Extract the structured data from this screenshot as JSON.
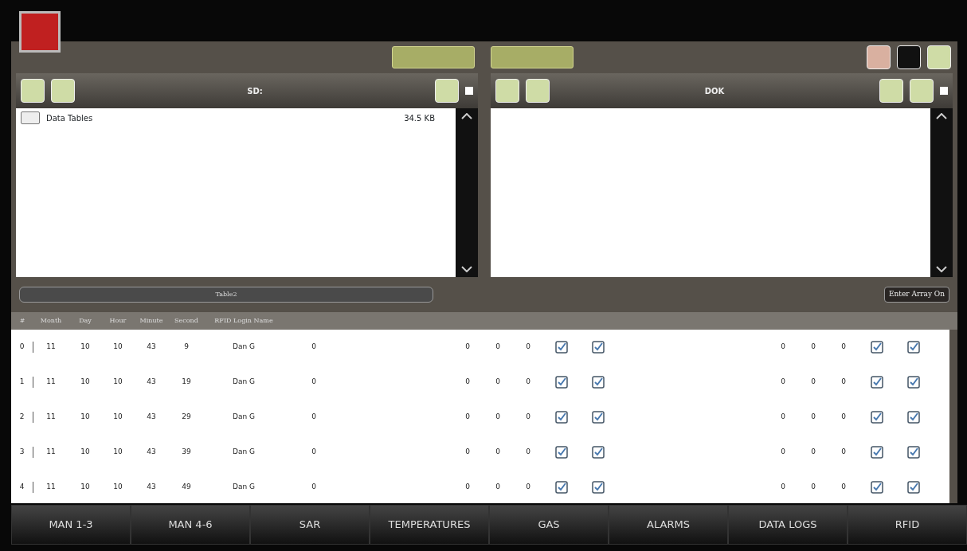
{
  "left_pane": {
    "title": "SD:",
    "select_all": false,
    "files": [
      {
        "name": "Data Tables",
        "size": "34.5 KB"
      }
    ]
  },
  "right_pane": {
    "title": "DOK",
    "select_all": false
  },
  "table": {
    "title": "Table2",
    "action": "Enter Array On",
    "columns": [
      "#",
      "Month",
      "Day",
      "Hour",
      "Minute",
      "Second",
      "RFID Login Name"
    ],
    "rows": [
      {
        "cells": [
          "0",
          "11",
          "10",
          "10",
          "43",
          "9",
          "Dan G",
          "0",
          "",
          "0",
          "0",
          "0"
        ],
        "checks": [
          true,
          true
        ],
        "tail": [
          "0",
          "0",
          "0"
        ],
        "tail_checks": [
          true,
          true
        ]
      },
      {
        "cells": [
          "1",
          "11",
          "10",
          "10",
          "43",
          "19",
          "Dan G",
          "0",
          "",
          "0",
          "0",
          "0"
        ],
        "checks": [
          true,
          true
        ],
        "tail": [
          "0",
          "0",
          "0"
        ],
        "tail_checks": [
          true,
          true
        ]
      },
      {
        "cells": [
          "2",
          "11",
          "10",
          "10",
          "43",
          "29",
          "Dan G",
          "0",
          "",
          "0",
          "0",
          "0"
        ],
        "checks": [
          true,
          true
        ],
        "tail": [
          "0",
          "0",
          "0"
        ],
        "tail_checks": [
          true,
          true
        ]
      },
      {
        "cells": [
          "3",
          "11",
          "10",
          "10",
          "43",
          "39",
          "Dan G",
          "0",
          "",
          "0",
          "0",
          "0"
        ],
        "checks": [
          true,
          true
        ],
        "tail": [
          "0",
          "0",
          "0"
        ],
        "tail_checks": [
          true,
          true
        ]
      },
      {
        "cells": [
          "4",
          "11",
          "10",
          "10",
          "43",
          "49",
          "Dan G",
          "0",
          "",
          "0",
          "0",
          "0"
        ],
        "checks": [
          true,
          true
        ],
        "tail": [
          "0",
          "0",
          "0"
        ],
        "tail_checks": [
          true,
          true
        ]
      }
    ]
  },
  "tabs": [
    {
      "label": "MAN 1-3",
      "selected": false
    },
    {
      "label": "MAN 4-6",
      "selected": false
    },
    {
      "label": "SAR",
      "selected": false
    },
    {
      "label": "TEMPERATURES",
      "selected": false
    },
    {
      "label": "GAS",
      "selected": false
    },
    {
      "label": "ALARMS",
      "selected": false
    },
    {
      "label": "DATA LOGS",
      "selected": false
    },
    {
      "label": "RFID",
      "selected": false
    }
  ]
}
